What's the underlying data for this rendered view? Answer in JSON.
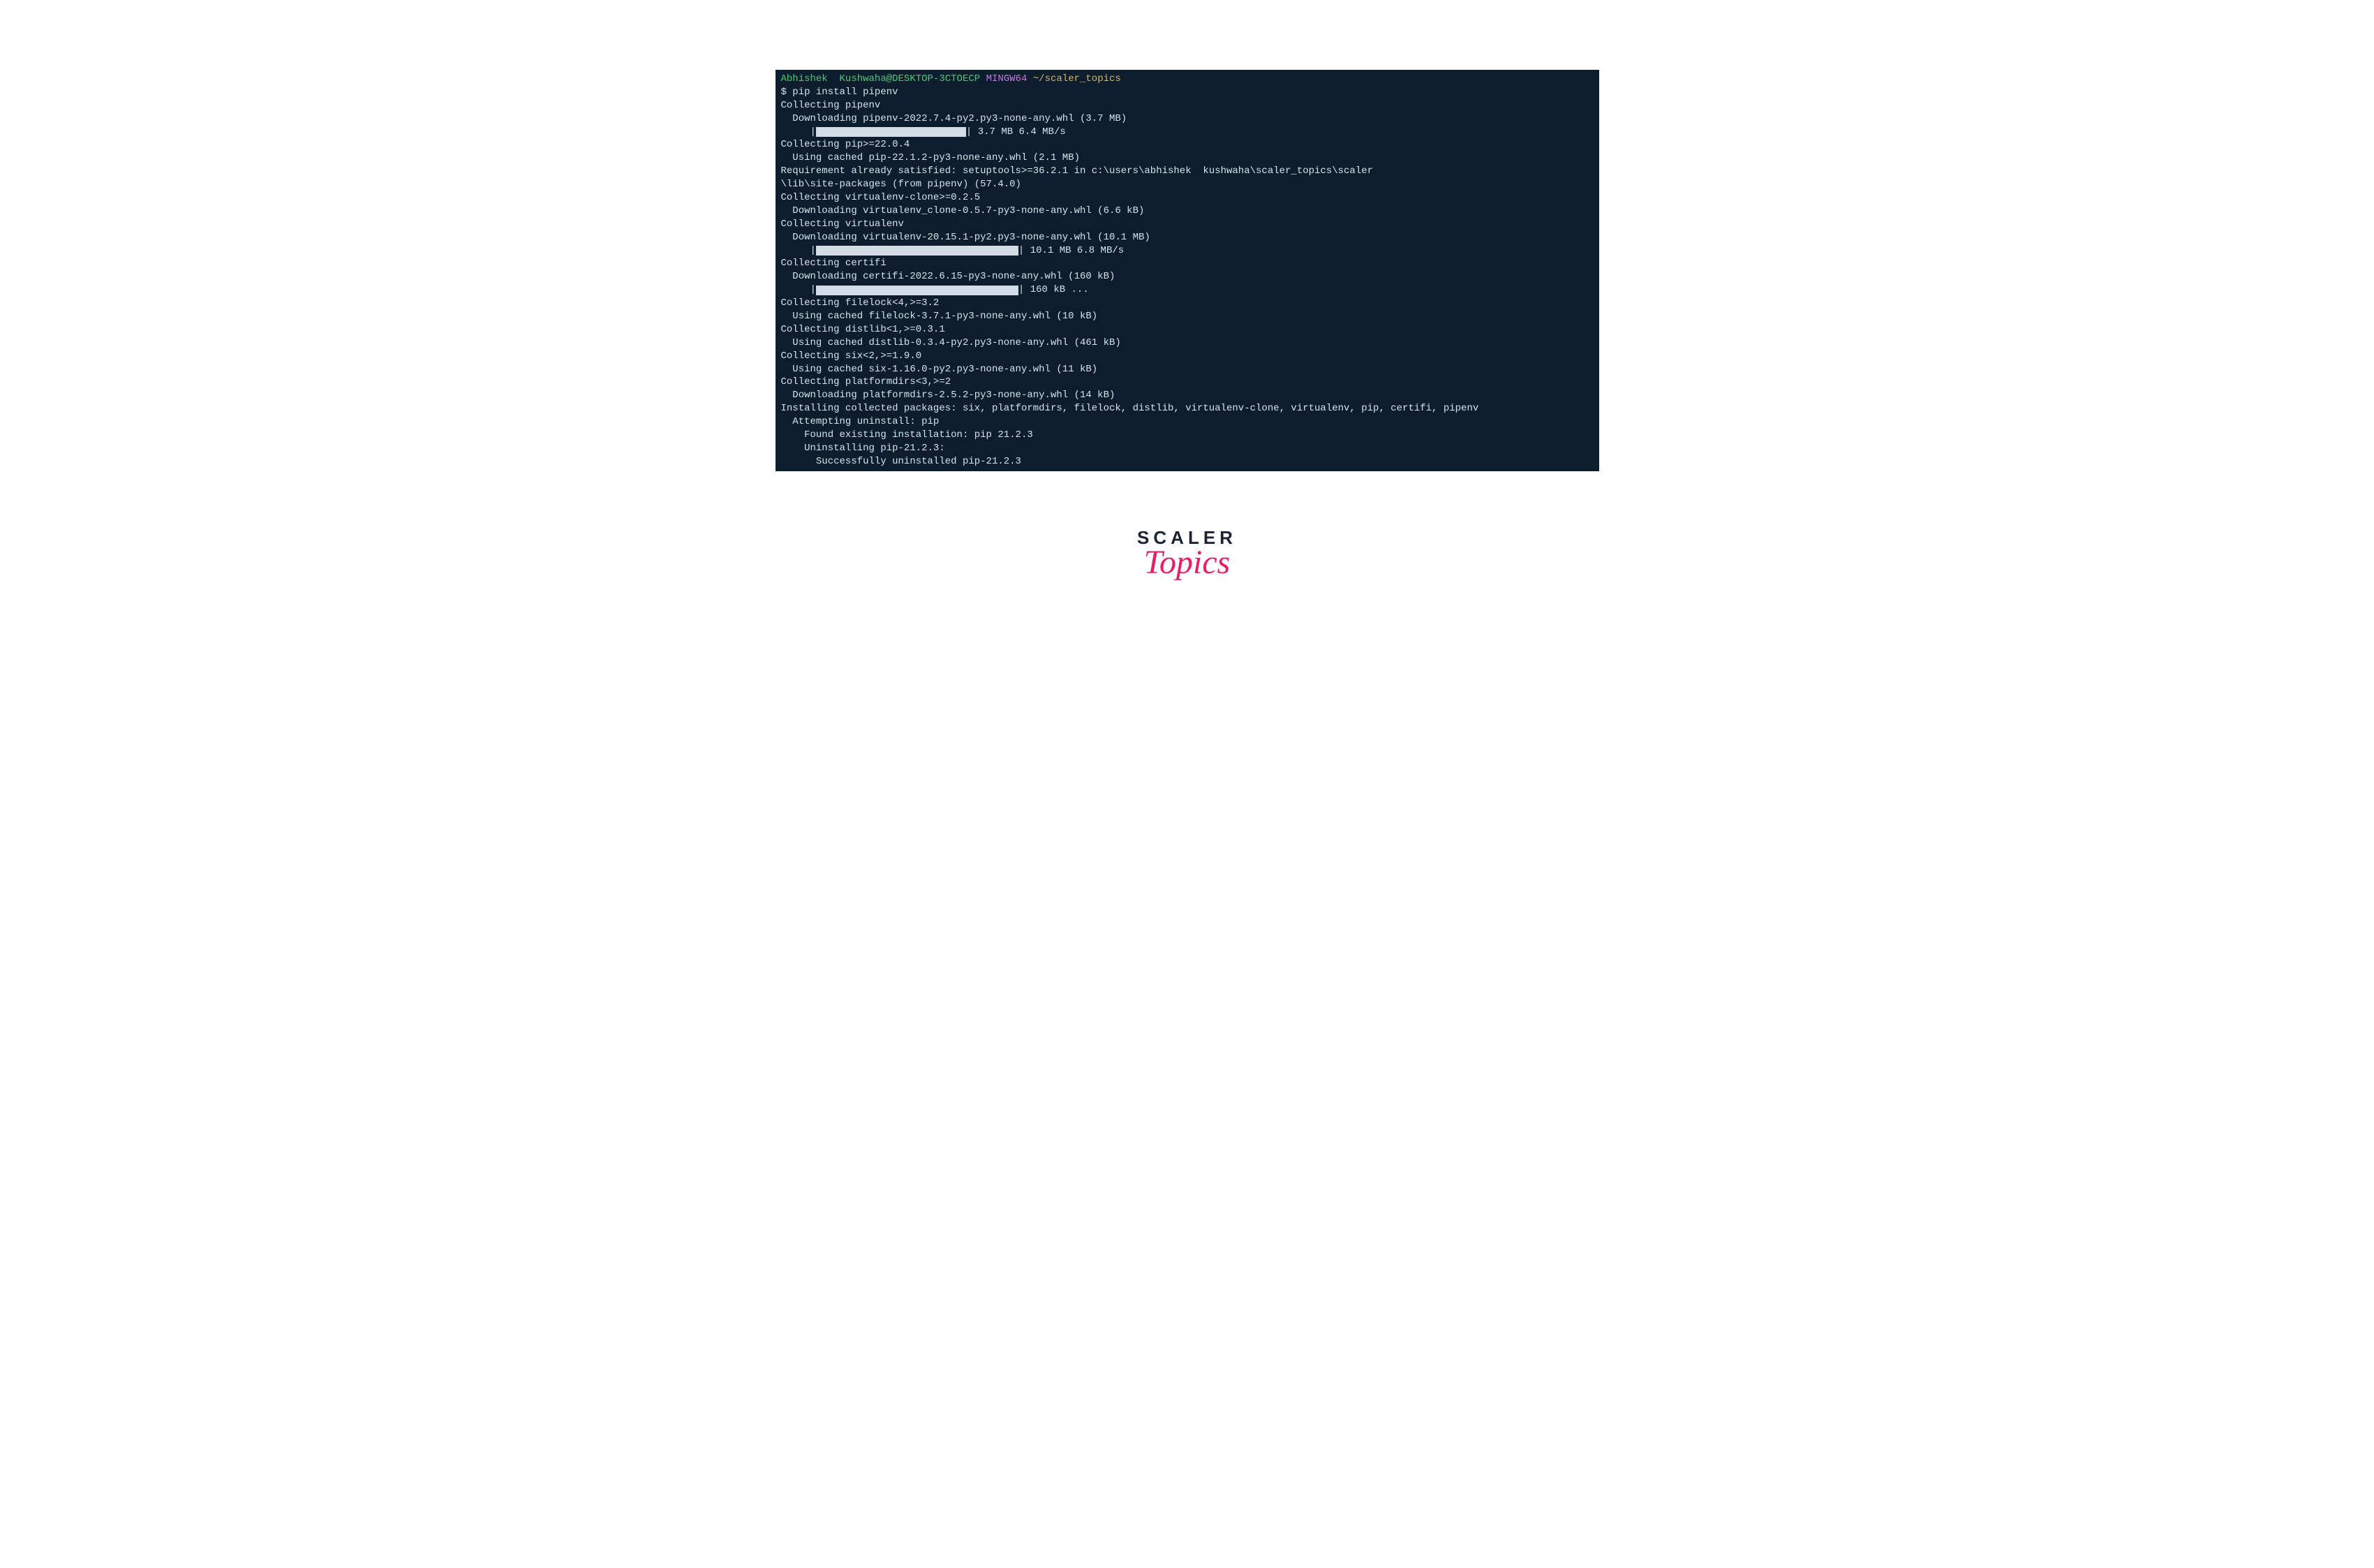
{
  "prompt": {
    "user_host": "Abhishek  Kushwaha@DESKTOP-3CTOECP",
    "shell": "MINGW64",
    "path": "~/scaler_topics"
  },
  "command": "$ pip install pipenv",
  "lines": {
    "l1": "Collecting pipenv",
    "l2": "  Downloading pipenv-2022.7.4-py2.py3-none-any.whl (3.7 MB)",
    "l3_prefix": "     |",
    "l3_suffix": "| 3.7 MB 6.4 MB/s",
    "l4": "Collecting pip>=22.0.4",
    "l5": "  Using cached pip-22.1.2-py3-none-any.whl (2.1 MB)",
    "l6": "Requirement already satisfied: setuptools>=36.2.1 in c:\\users\\abhishek  kushwaha\\scaler_topics\\scaler",
    "l7": "\\lib\\site-packages (from pipenv) (57.4.0)",
    "l8": "Collecting virtualenv-clone>=0.2.5",
    "l9": "  Downloading virtualenv_clone-0.5.7-py3-none-any.whl (6.6 kB)",
    "l10": "Collecting virtualenv",
    "l11": "  Downloading virtualenv-20.15.1-py2.py3-none-any.whl (10.1 MB)",
    "l12_prefix": "     |",
    "l12_suffix": "| 10.1 MB 6.8 MB/s",
    "l13": "Collecting certifi",
    "l14": "  Downloading certifi-2022.6.15-py3-none-any.whl (160 kB)",
    "l15_prefix": "     |",
    "l15_suffix": "| 160 kB ...",
    "l16": "Collecting filelock<4,>=3.2",
    "l17": "  Using cached filelock-3.7.1-py3-none-any.whl (10 kB)",
    "l18": "Collecting distlib<1,>=0.3.1",
    "l19": "  Using cached distlib-0.3.4-py2.py3-none-any.whl (461 kB)",
    "l20": "Collecting six<2,>=1.9.0",
    "l21": "  Using cached six-1.16.0-py2.py3-none-any.whl (11 kB)",
    "l22": "Collecting platformdirs<3,>=2",
    "l23": "  Downloading platformdirs-2.5.2-py3-none-any.whl (14 kB)",
    "l24": "Installing collected packages: six, platformdirs, filelock, distlib, virtualenv-clone, virtualenv, pip, certifi, pipenv",
    "l25": "  Attempting uninstall: pip",
    "l26": "    Found existing installation: pip 21.2.3",
    "l27": "    Uninstalling pip-21.2.3:",
    "l28": "      Successfully uninstalled pip-21.2.3"
  },
  "logo": {
    "scaler": "SCALER",
    "topics": "Topics"
  }
}
